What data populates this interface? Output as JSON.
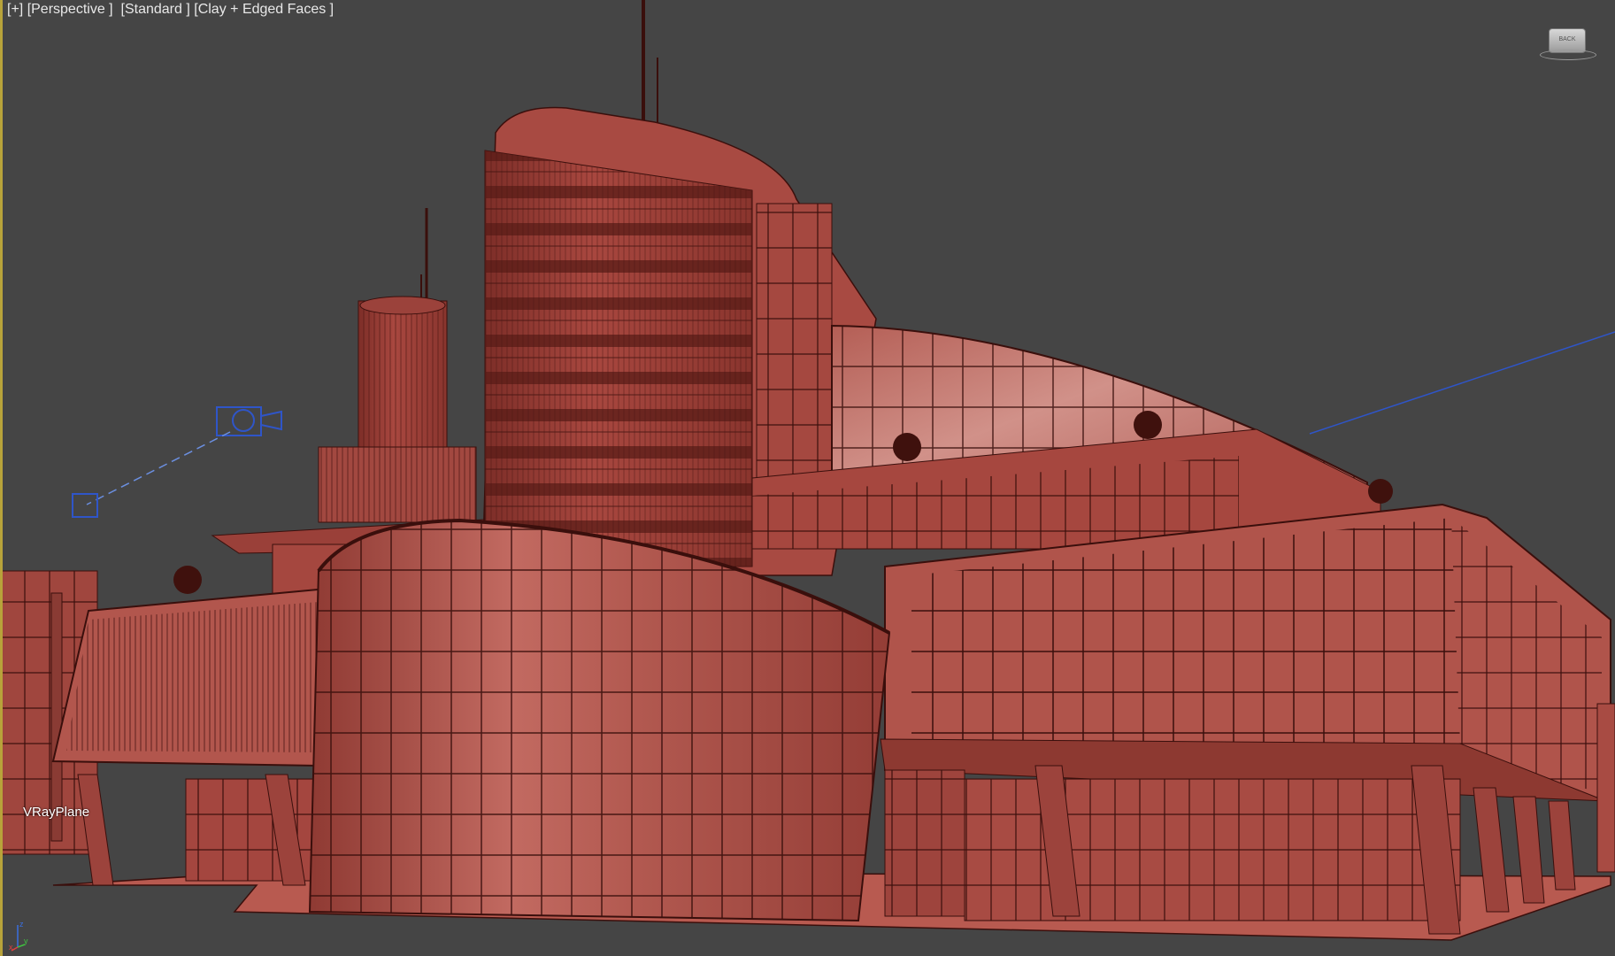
{
  "viewport": {
    "label_plus": "[+]",
    "label_view": "[Perspective ]",
    "label_shading_standard": "[Standard ]",
    "label_shading_mode": "[Clay + Edged Faces ]",
    "object_label": "VRayPlane",
    "viewcube_text": "BACK",
    "axis_labels": {
      "x": "x",
      "y": "y",
      "z": "z"
    }
  },
  "colors": {
    "background": "#454545",
    "model_clay": "#b3554d",
    "edges": "#3a0f0c",
    "selection_blue": "#2f55c8",
    "viewport_border": "#b8a33a"
  },
  "icons": [
    "viewcube-icon",
    "light-icon",
    "light-target-icon",
    "axis-tripod-icon"
  ]
}
